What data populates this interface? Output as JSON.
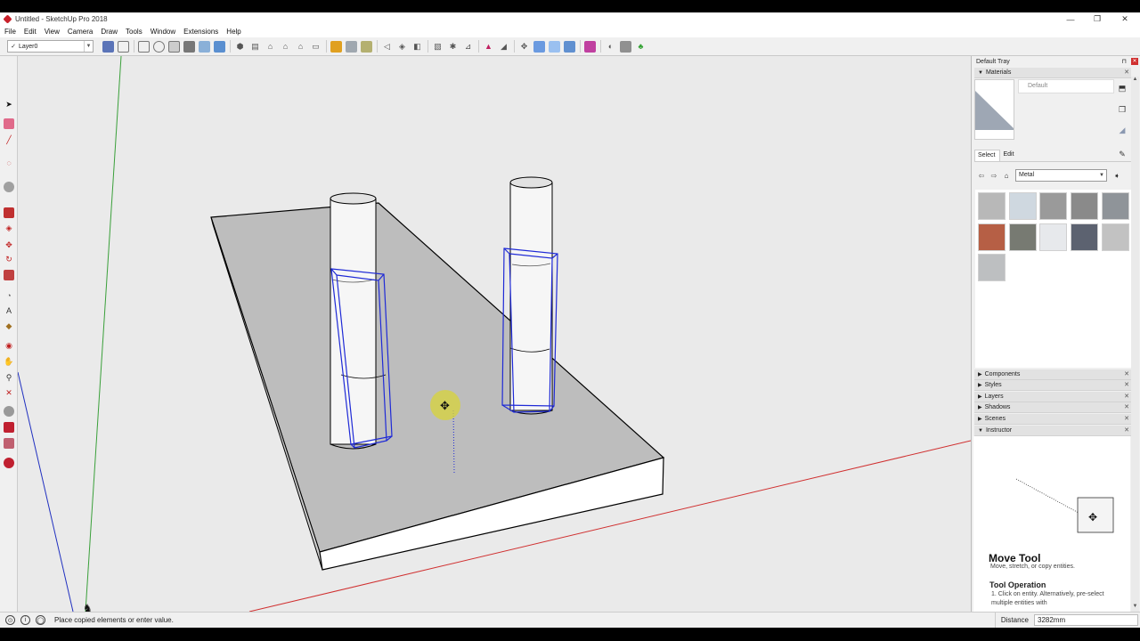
{
  "window": {
    "title": "Untitled - SketchUp Pro 2018",
    "controls": {
      "minimize": "—",
      "maximize": "❐",
      "close": "✕"
    }
  },
  "menu": [
    "File",
    "Edit",
    "View",
    "Camera",
    "Draw",
    "Tools",
    "Window",
    "Extensions",
    "Help"
  ],
  "toolbar": {
    "layer_name": "Layer0",
    "layer_check": "✓"
  },
  "status": {
    "message": "Place copied elements or enter value.",
    "measure_label": "Distance",
    "measure_value": "3282mm"
  },
  "tray": {
    "title": "Default Tray",
    "materials": {
      "label": "Materials",
      "current_name": "Default",
      "tabs": [
        "Select",
        "Edit"
      ],
      "library": "Metal",
      "swatch_colors": [
        "#b8b8b8",
        "#cfd8e0",
        "#9a9a9a",
        "#8a8a8a",
        "#8f9499",
        "#b65f45",
        "#777a72",
        "#e7e9ec",
        "#5c6270",
        "#c2c2c2",
        "#bdbfc1"
      ]
    },
    "panels": [
      "Components",
      "Styles",
      "Layers",
      "Shadows",
      "Scenes",
      "Instructor"
    ],
    "instructor": {
      "title": "Move Tool",
      "description": "Move, stretch, or copy entities.",
      "operation_title": "Tool Operation",
      "step1": "1. Click on entity. Alternatively, pre-select multiple entities with"
    }
  },
  "colors": {
    "viewport_bg": "#eaeaea",
    "selection": "#1f2ad6",
    "red_axis": "#d03030",
    "green_axis": "#3aa03a",
    "blue_axis": "#2030c0"
  }
}
